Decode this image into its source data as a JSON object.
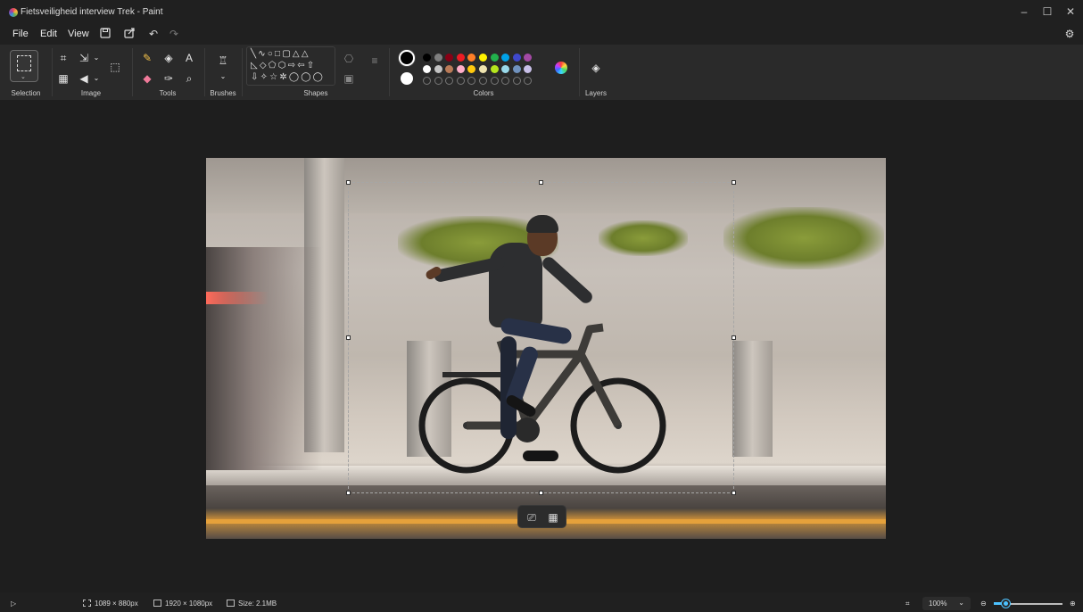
{
  "window": {
    "title": "Fietsveiligheid interview Trek - Paint",
    "minimize": "–",
    "maximize": "☐",
    "close": "✕"
  },
  "menu": {
    "file": "File",
    "edit": "Edit",
    "view": "View"
  },
  "ribbon": {
    "selection_label": "Selection",
    "image_label": "Image",
    "tools_label": "Tools",
    "brushes_label": "Brushes",
    "shapes_label": "Shapes",
    "colors_label": "Colors",
    "layers_label": "Layers",
    "shapes_row1": "╲∿○□▢△△",
    "shapes_row2": "◺◇⬠⬡⇨⇦⇧",
    "shapes_row3": "⇩✧☆✲◯◯◯",
    "palette_row1": [
      "#000000",
      "#7f7f7f",
      "#880015",
      "#ed1c24",
      "#ff7f27",
      "#fff200",
      "#22b14c",
      "#00a2e8",
      "#3f48cc",
      "#a349a4"
    ],
    "palette_row2": [
      "#ffffff",
      "#c3c3c3",
      "#b97a57",
      "#ffaec9",
      "#ffc90e",
      "#efe4b0",
      "#b5e61d",
      "#99d9ea",
      "#7092be",
      "#c8bfe7"
    ],
    "primary_color": "#000000",
    "secondary_color": "#ffffff"
  },
  "status": {
    "selection_size": "1089 × 880px",
    "canvas_size": "1920 × 1080px",
    "file_size": "Size: 2.1MB",
    "zoom": "100%"
  }
}
